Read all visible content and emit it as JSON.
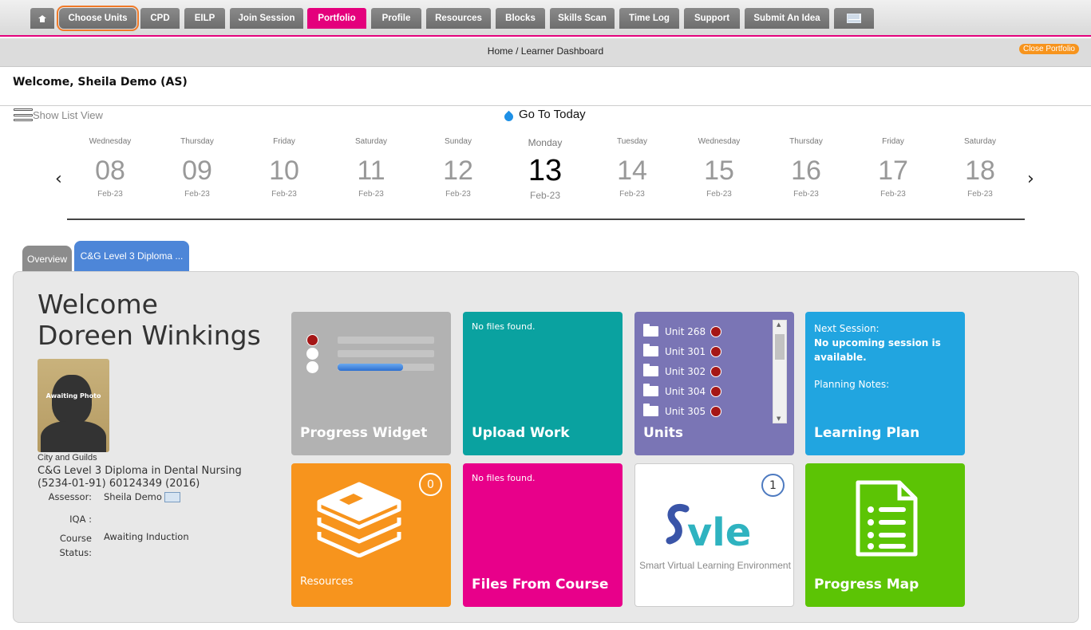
{
  "nav": {
    "items": [
      {
        "label": ""
      },
      {
        "label": "Choose Units"
      },
      {
        "label": "CPD"
      },
      {
        "label": "EILP"
      },
      {
        "label": "Join Session"
      },
      {
        "label": "Portfolio"
      },
      {
        "label": "Profile"
      },
      {
        "label": "Resources"
      },
      {
        "label": "Blocks"
      },
      {
        "label": "Skills Scan"
      },
      {
        "label": "Time Log"
      },
      {
        "label": "Support"
      },
      {
        "label": "Submit An Idea"
      },
      {
        "label": ""
      }
    ],
    "active_color": "#e4007c"
  },
  "breadcrumb": {
    "text": "Home / Learner Dashboard"
  },
  "close_portfolio": "Close Portfolio",
  "welcome_line": "Welcome, Sheila Demo (AS)",
  "list_view": "Show List View",
  "go_to_today": "Go To Today",
  "calendar": {
    "days": [
      {
        "name": "Wednesday",
        "num": "08",
        "mon": "Feb-23"
      },
      {
        "name": "Thursday",
        "num": "09",
        "mon": "Feb-23"
      },
      {
        "name": "Friday",
        "num": "10",
        "mon": "Feb-23"
      },
      {
        "name": "Saturday",
        "num": "11",
        "mon": "Feb-23"
      },
      {
        "name": "Sunday",
        "num": "12",
        "mon": "Feb-23"
      },
      {
        "name": "Monday",
        "num": "13",
        "mon": "Feb-23"
      },
      {
        "name": "Tuesday",
        "num": "14",
        "mon": "Feb-23"
      },
      {
        "name": "Wednesday",
        "num": "15",
        "mon": "Feb-23"
      },
      {
        "name": "Thursday",
        "num": "16",
        "mon": "Feb-23"
      },
      {
        "name": "Friday",
        "num": "17",
        "mon": "Feb-23"
      },
      {
        "name": "Saturday",
        "num": "18",
        "mon": "Feb-23"
      }
    ],
    "prev": "‹",
    "next": "›"
  },
  "tabs": {
    "overview": "Overview",
    "course": "C&G Level 3 Diploma ..."
  },
  "learner": {
    "welcome": "Welcome",
    "name": "Doreen Winkings",
    "photo_text": "Awaiting Photo",
    "institution": "City and Guilds",
    "qualification": "C&G Level 3 Diploma in Dental Nursing (5234-01-91) 60124349 (2016)",
    "assessor_label": "Assessor:",
    "assessor": "Sheila Demo",
    "iqa_label": "IQA :",
    "course_status_label": "Course Status:",
    "course_status": "Awaiting Induction"
  },
  "tiles": {
    "progress": {
      "title": "Progress Widget",
      "bar_fill": 0.68
    },
    "upload": {
      "title": "Upload Work",
      "note": "No files found."
    },
    "units": {
      "title": "Units",
      "items": [
        "Unit 268",
        "Unit 301",
        "Unit 302",
        "Unit 304",
        "Unit 305"
      ]
    },
    "plan": {
      "title": "Learning Plan",
      "next_label": "Next Session:",
      "next_text": "No upcoming session is available.",
      "notes_label": "Planning Notes:"
    },
    "resources": {
      "title": "Resources",
      "count": "0"
    },
    "files": {
      "title": "Files From Course",
      "note": "No files found."
    },
    "svle": {
      "logo": "Svle",
      "subtitle": "Smart Virtual Learning Environment",
      "count": "1"
    },
    "map": {
      "title": "Progress Map"
    }
  }
}
